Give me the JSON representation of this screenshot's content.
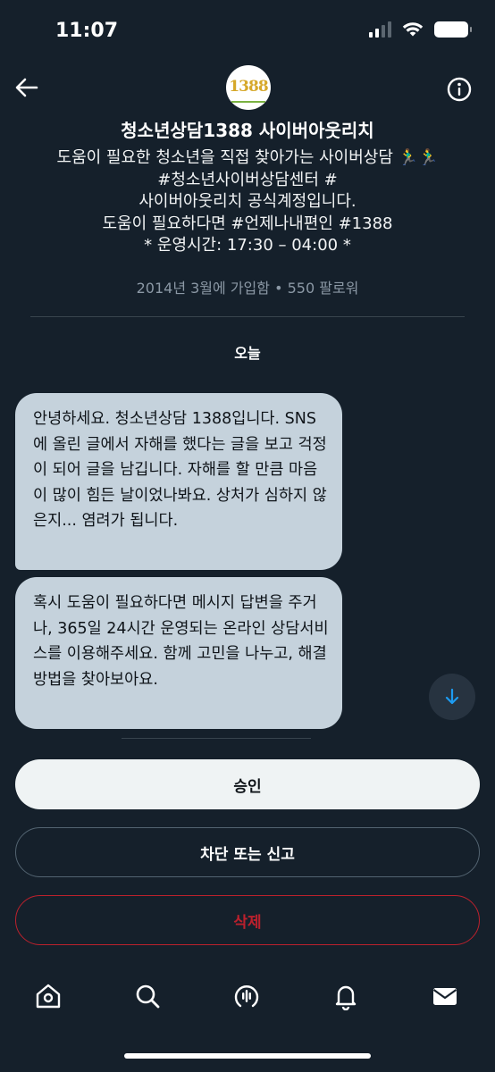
{
  "status_bar": {
    "time": "11:07"
  },
  "profile": {
    "avatar_text": "1388",
    "name": "청소년상담1388 사이버아웃리치",
    "bio_lines": [
      "도움이 필요한 청소년을 직접 찾아가는 사이버상담 🏃‍♂️🏃‍♂️",
      "#청소년사이버상담센터 #",
      "사이버아웃리치 공식계정입니다.",
      "도움이 필요하다면 #언제나내편인 #1388",
      "* 운영시간: 17:30 – 04:00 *"
    ],
    "joined": "2014년 3월에 가입함 • 550 팔로워"
  },
  "conversation": {
    "date_label": "오늘",
    "messages": [
      {
        "text": "안녕하세요. 청소년상담 1388입니다. SNS에 올린 글에서 자해를 했다는 글을 보고 걱정이 되어 글을 남깁니다. 자해를 할 만큼 마음이 많이 힘든 날이었나봐요. 상처가 심하지 않은지... 염려가 됩니다."
      },
      {
        "text": "혹시 도움이 필요하다면 메시지 답변을 주거나, 365일 24시간 운영되는 온라인 상담서비스를 이용해주세요. 함께 고민을 나누고, 해결방법을 찾아보아요."
      }
    ]
  },
  "actions": {
    "accept_label": "승인",
    "block_label": "차단 또는 신고",
    "delete_label": "삭제"
  },
  "icons": {
    "back": "back-arrow-icon",
    "info": "info-icon",
    "scroll": "arrow-down-icon",
    "tabs": [
      "home-icon",
      "search-icon",
      "spaces-icon",
      "notifications-icon",
      "messages-icon"
    ]
  },
  "colors": {
    "background": "#15202b",
    "bubble": "#c5d2dc",
    "delete": "#f4212e"
  }
}
